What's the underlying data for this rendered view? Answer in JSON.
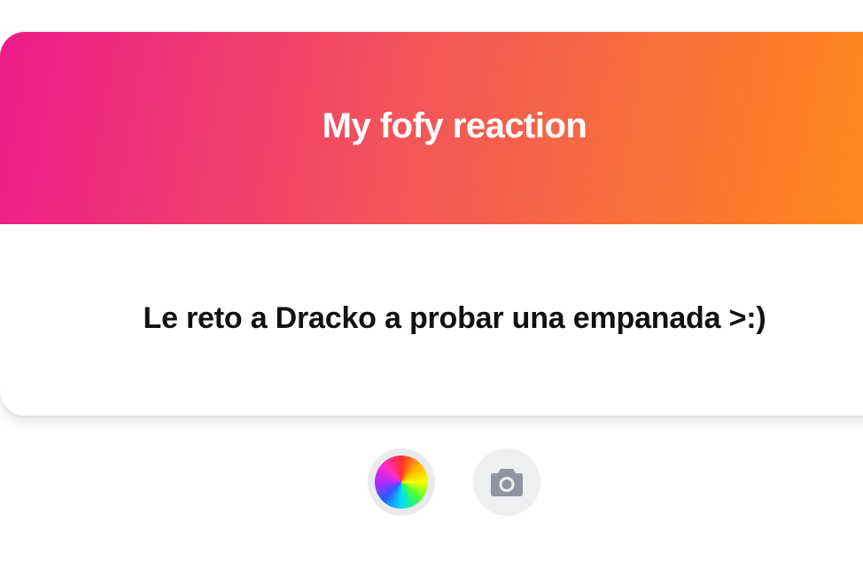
{
  "card": {
    "title": "My fofy reaction",
    "message": "Le reto a Dracko a probar una empanada >:)"
  },
  "colors": {
    "gradient_start": "#ec1c8c",
    "gradient_mid": "#f2545a",
    "gradient_end": "#fe8a1a",
    "camera_icon": "#8f959e"
  },
  "controls": {
    "color_picker_icon": "color-wheel-icon",
    "camera_icon": "camera-icon"
  }
}
